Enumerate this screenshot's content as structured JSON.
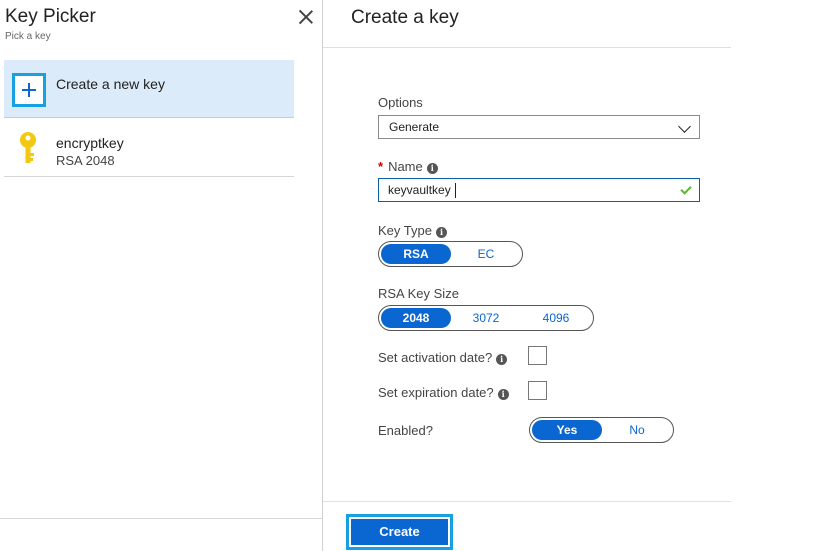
{
  "picker": {
    "title": "Key Picker",
    "subtitle": "Pick a key",
    "create_label": "Create a new key",
    "keys": [
      {
        "name": "encryptkey",
        "detail": "RSA 2048",
        "icon": "key-icon",
        "icon_color": "#f2c811"
      }
    ]
  },
  "form": {
    "title": "Create a key",
    "options": {
      "label": "Options",
      "value": "Generate"
    },
    "name": {
      "label": "Name",
      "value": "keyvaultkey",
      "required": true,
      "valid": true
    },
    "key_type": {
      "label": "Key Type",
      "options": [
        "RSA",
        "EC"
      ],
      "selected": "RSA"
    },
    "rsa_key_size": {
      "label": "RSA Key Size",
      "options": [
        "2048",
        "3072",
        "4096"
      ],
      "selected": "2048"
    },
    "activation": {
      "label": "Set activation date?",
      "checked": false
    },
    "expiration": {
      "label": "Set expiration date?",
      "checked": false
    },
    "enabled": {
      "label": "Enabled?",
      "options": [
        "Yes",
        "No"
      ],
      "selected": "Yes"
    },
    "create_button": "Create"
  },
  "colors": {
    "accent": "#0a66d1",
    "selection_bg": "#dcebfa",
    "focus_outline": "#19a0e0",
    "valid_check": "#5cb82e",
    "required": "#c80000"
  }
}
